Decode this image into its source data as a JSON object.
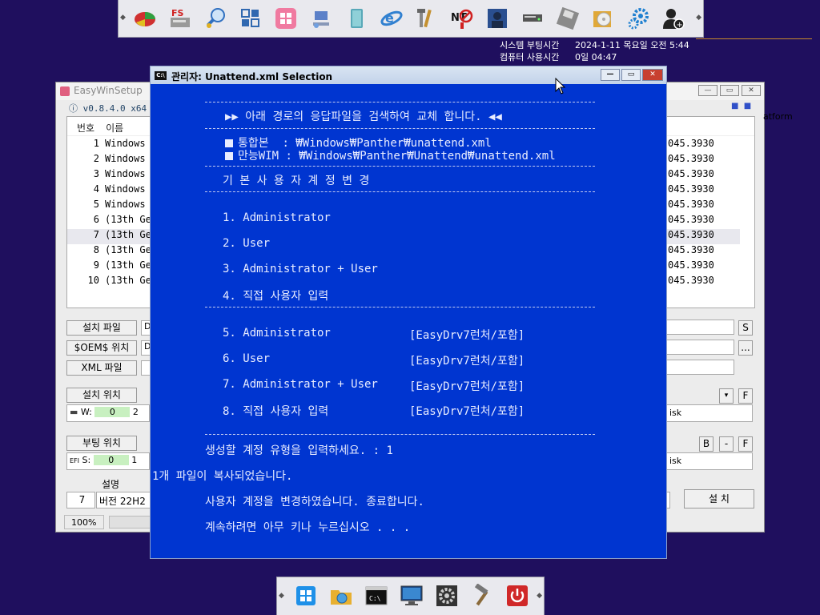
{
  "sysinfo": {
    "boot_label": "시스템 부팅시간",
    "boot_value": "2024-1-11 목요일 오전 5:44",
    "uptime_label": "컴퓨터 사용시간",
    "uptime_value": "0일 04:47"
  },
  "bg": {
    "title": "EasyWinSetup",
    "version": "v0.8.4.0 x64",
    "col_no": "번호",
    "col_name": "이름",
    "rows": [
      {
        "no": "1",
        "name": "Windows",
        "ver": "045.3930"
      },
      {
        "no": "2",
        "name": "Windows",
        "ver": "045.3930"
      },
      {
        "no": "3",
        "name": "Windows",
        "ver": "045.3930"
      },
      {
        "no": "4",
        "name": "Windows",
        "ver": "045.3930"
      },
      {
        "no": "5",
        "name": "Windows",
        "ver": "045.3930"
      },
      {
        "no": "6",
        "name": "(13th Ge",
        "ver": "045.3930"
      },
      {
        "no": "7",
        "name": "(13th Ge",
        "ver": "045.3930"
      },
      {
        "no": "8",
        "name": "(13th Ge",
        "ver": "045.3930"
      },
      {
        "no": "9",
        "name": "(13th Ge",
        "ver": "045.3930"
      },
      {
        "no": "10",
        "name": "(13th Ge",
        "ver": "045.3930"
      }
    ],
    "platform": "atform",
    "btn_install_file": "설치 파일",
    "btn_oem": "$OEM$ 위치",
    "btn_xml": "XML 파일",
    "field1": "D",
    "field2": "D",
    "btn_s": "S",
    "btn_dots": "...",
    "btn_install_loc": "설치 위치",
    "w_label": "W:",
    "w_val": "0",
    "w_extra": "2",
    "disk1": "isk",
    "btn_boot_loc": "부팅 위치",
    "efi_label": "EFI",
    "s_label": "S:",
    "s_val": "0",
    "s_extra": "1",
    "disk2": "isk",
    "btn_dd": "▾",
    "btn_f": "F",
    "btn_b": "B",
    "btn_minus": "-",
    "btn_f2": "F",
    "desc_label": "설명",
    "desc_no": "7",
    "desc_text": "버전 22H2",
    "btn_install": "설 치",
    "zoom": "100%"
  },
  "console": {
    "title": "관리자: Unattend.xml Selection",
    "header": "▶▶ 아래 경로의 응답파일을 검색하여 교체 합니다. ◀◀",
    "path1": "통합본  : ₩Windows₩Panther₩unattend.xml",
    "path2": "만능WIM : ₩Windows₩Panther₩Unattend₩unattend.xml",
    "section": "기 본 사 용 자 계 정 변 경",
    "opt1": "1. Administrator",
    "opt2": "2. User",
    "opt3": "3. Administrator + User",
    "opt4": "4. 직접 사용자 입력",
    "opt5": "5. Administrator",
    "opt6": "6. User",
    "opt7": "7. Administrator + User",
    "opt8": "8. 직접 사용자 입력",
    "tag": "[EasyDrv7런처/포함]",
    "prompt": "생성할 계정 유형을 입력하세요. : 1",
    "copied": "1개 파일이 복사되었습니다.",
    "changed": "사용자 계정을 변경하였습니다. 종료합니다.",
    "continue": "계속하려면 아무 키나 누르십시오 . . ."
  },
  "top_icons": [
    "partition-icon",
    "fs-icon",
    "search-user-icon",
    "grid-icon",
    "windows-tile-icon",
    "network-pc-icon",
    "book-icon",
    "ie-icon",
    "tools-icon",
    "not-icon",
    "user-photo-icon",
    "drive-icon",
    "floppy-icon",
    "disc-box-icon",
    "gears-icon",
    "add-user-icon"
  ],
  "bottom_icons": [
    "windows-icon",
    "explorer-icon",
    "cmd-icon",
    "monitor-icon",
    "settings-icon",
    "hammer-icon",
    "power-icon"
  ]
}
